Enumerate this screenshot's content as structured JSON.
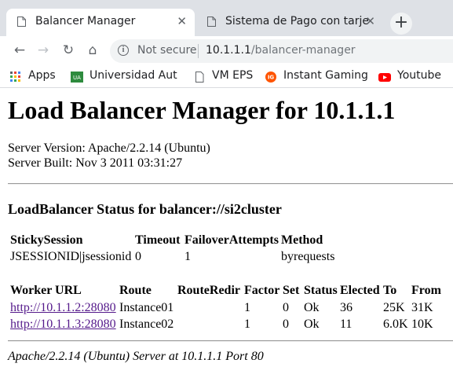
{
  "browser": {
    "tabs": [
      {
        "title": "Balancer Manager",
        "close": "✕"
      },
      {
        "title": "Sistema de Pago con tarje",
        "close": "✕"
      }
    ],
    "new_tab": "+",
    "nav": {
      "back": "←",
      "forward": "→",
      "reload": "↻",
      "home": "⌂"
    },
    "address": {
      "security": "Not secure",
      "host": "10.1.1.1",
      "path": "/balancer-manager",
      "info": "i"
    },
    "bookmarks": [
      {
        "label": "Apps",
        "icon": "apps-grid-icon"
      },
      {
        "label": "Universidad Aut",
        "icon": "university-icon",
        "badge": "UA"
      },
      {
        "label": "VM EPS",
        "icon": "page-icon"
      },
      {
        "label": "Instant Gaming",
        "icon": "instant-gaming-icon",
        "badge": "IG"
      },
      {
        "label": "Youtube",
        "icon": "youtube-icon"
      }
    ],
    "colors": {
      "tabbar": "#dee1e6",
      "instant_gaming": "#ff5400",
      "youtube": "#ff0000",
      "university": "#2e8b3e"
    }
  },
  "page": {
    "title": "Load Balancer Manager for 10.1.1.1",
    "server_version": "Server Version: Apache/2.2.14 (Ubuntu)",
    "server_built": "Server Built: Nov 3 2011 03:31:27",
    "balancer_heading": "LoadBalancer Status for balancer://si2cluster",
    "status_table": {
      "headers": [
        "StickySession",
        "Timeout",
        "FailoverAttempts",
        "Method"
      ],
      "row": [
        "JSESSIONID|jsessionid",
        "0",
        "1",
        "byrequests"
      ]
    },
    "workers_table": {
      "headers": [
        "Worker URL",
        "Route",
        "RouteRedir",
        "Factor",
        "Set",
        "Status",
        "Elected",
        "To",
        "From"
      ],
      "rows": [
        [
          "http://10.1.1.2:28080",
          "Instance01",
          "",
          "1",
          "0",
          "Ok",
          "36",
          "25K",
          "31K"
        ],
        [
          "http://10.1.1.3:28080",
          "Instance02",
          "",
          "1",
          "0",
          "Ok",
          "11",
          "6.0K",
          "10K"
        ]
      ]
    },
    "footer": "Apache/2.2.14 (Ubuntu) Server at 10.1.1.1 Port 80"
  }
}
